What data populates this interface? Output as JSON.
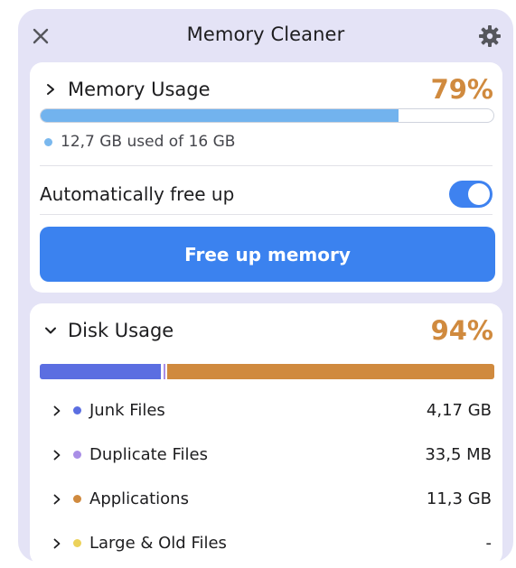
{
  "app": {
    "title": "Memory Cleaner",
    "close_icon": "close-icon",
    "settings_icon": "gear-icon"
  },
  "memory": {
    "title": "Memory Usage",
    "percent_label": "79%",
    "percent_value": 79,
    "used_text": "12,7 GB used of 16 GB",
    "used_dot_color": "#7ab8ee",
    "auto_label": "Automatically free up",
    "auto_enabled": true,
    "button_label": "Free up memory"
  },
  "disk": {
    "title": "Disk Usage",
    "percent_label": "94%",
    "percent_value": 94,
    "items": [
      {
        "label": "Junk Files",
        "size": "4,17 GB",
        "color": "#5b6ee1"
      },
      {
        "label": "Duplicate Files",
        "size": "33,5 MB",
        "color": "#a98ee6"
      },
      {
        "label": "Applications",
        "size": "11,3 GB",
        "color": "#d08a3e"
      },
      {
        "label": "Large & Old Files",
        "size": "-",
        "color": "#ecd25a"
      }
    ]
  },
  "colors": {
    "accent": "#3b82ef",
    "percent": "#d08a3e",
    "window_bg": "#e4e3f6"
  }
}
